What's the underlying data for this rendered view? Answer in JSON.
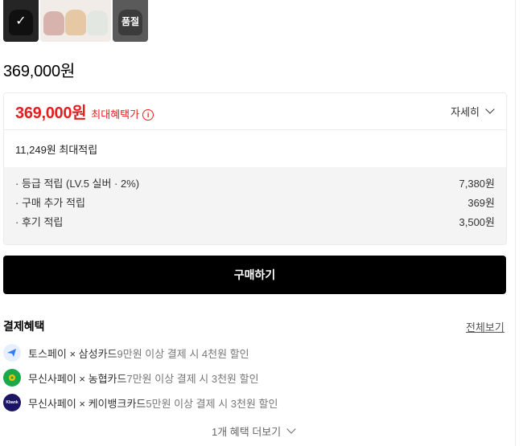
{
  "thumbnails": {
    "sold_out_label": "품절"
  },
  "price": "369,000원",
  "price_box": {
    "max_benefit_price": "369,000원",
    "max_benefit_label": "최대혜택가",
    "detail_label": "자세히",
    "max_accumulation": "11,249원 최대적립",
    "rows": [
      {
        "label": "· 등급 적립 (LV.5 실버 · 2%)",
        "value": "7,380원"
      },
      {
        "label": "· 구매 추가 적립",
        "value": "369원"
      },
      {
        "label": "· 후기 적립",
        "value": "3,500원"
      }
    ]
  },
  "buy_button": "구매하기",
  "payment": {
    "title": "결제혜택",
    "see_all": "전체보기",
    "benefits": [
      {
        "icon": "toss-pay-icon",
        "main": "토스페이 × 삼성카드",
        "rest": " 9만원 이상 결제 시 4천원 할인"
      },
      {
        "icon": "musinsa-pay-nh-icon",
        "main": "무신사페이 × 농협카드",
        "rest": " 7만원 이상 결제 시 3천원 할인"
      },
      {
        "icon": "kbank-icon",
        "logo_text": "Kbank",
        "main": "무신사페이 × 케이뱅크카드",
        "rest": " 5만원 이상 결제 시 3천원 할인"
      }
    ],
    "more_label": "1개 혜택 더보기"
  },
  "colors": {
    "accent_red": "#e51f1f",
    "button_black": "#000000"
  }
}
